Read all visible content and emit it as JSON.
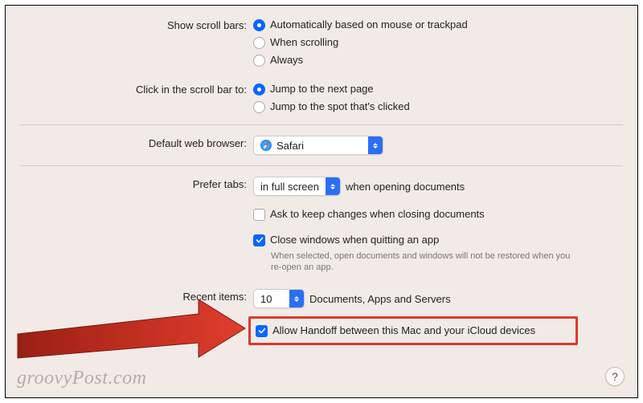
{
  "scrollBars": {
    "label": "Show scroll bars:",
    "options": [
      "Automatically based on mouse or trackpad",
      "When scrolling",
      "Always"
    ],
    "selected": 0
  },
  "clickInScrollBar": {
    "label": "Click in the scroll bar to:",
    "options": [
      "Jump to the next page",
      "Jump to the spot that's clicked"
    ],
    "selected": 0
  },
  "defaultBrowser": {
    "label": "Default web browser:",
    "value": "Safari"
  },
  "preferTabs": {
    "label": "Prefer tabs:",
    "value": "in full screen",
    "suffix": "when opening documents"
  },
  "askToKeep": {
    "label": "Ask to keep changes when closing documents",
    "checked": false
  },
  "closeWindows": {
    "label": "Close windows when quitting an app",
    "hint": "When selected, open documents and windows will not be restored when you re-open an app.",
    "checked": true
  },
  "recentItems": {
    "label": "Recent items:",
    "value": "10",
    "suffix": "Documents, Apps and Servers"
  },
  "allowHandoff": {
    "label": "Allow Handoff between this Mac and your iCloud devices",
    "checked": true
  },
  "helpTooltip": "?",
  "watermark": "groovyPost.com"
}
